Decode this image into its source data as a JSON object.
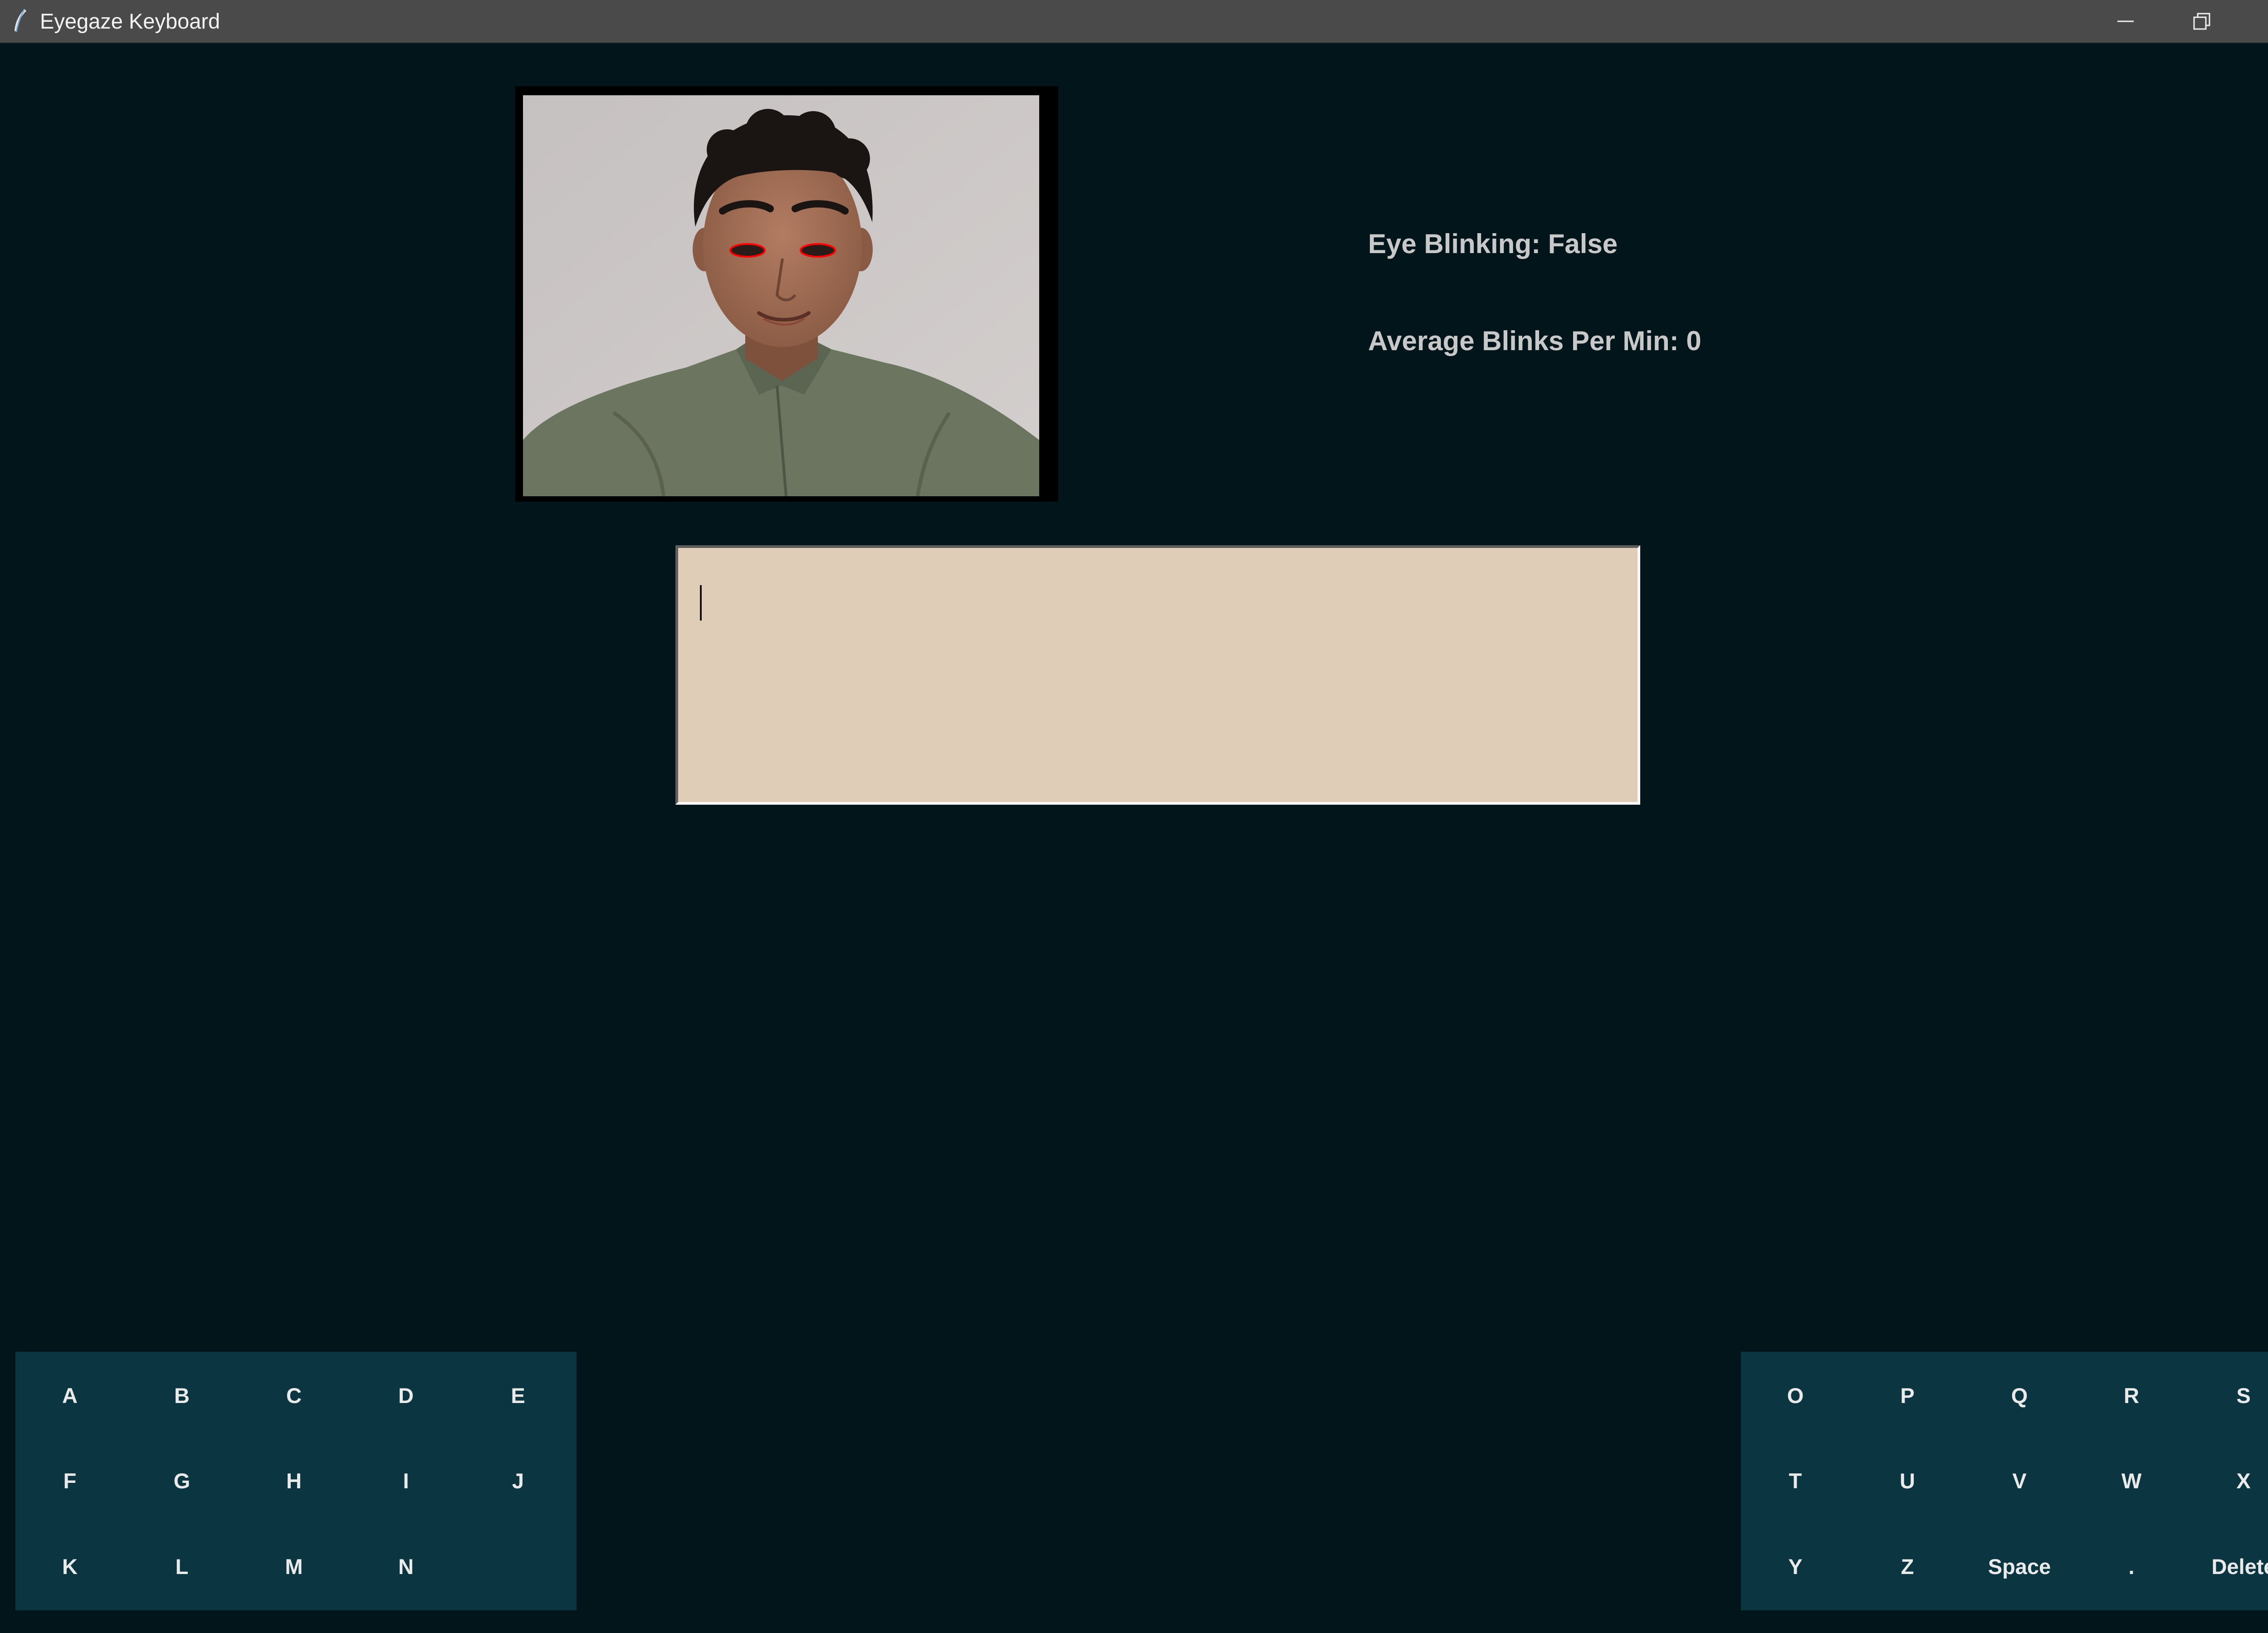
{
  "window": {
    "title": "Eyegaze Keyboard",
    "icon": "feather-icon"
  },
  "status": {
    "eye_blinking": "Eye Blinking: False",
    "average_blinks": "Average Blinks Per Min: 0"
  },
  "textbox": {
    "value": ""
  },
  "keyboard": {
    "left_rows": [
      [
        "A",
        "B",
        "C",
        "D",
        "E"
      ],
      [
        "F",
        "G",
        "H",
        "I",
        "J"
      ],
      [
        "K",
        "L",
        "M",
        "N"
      ]
    ],
    "right_rows": [
      [
        "O",
        "P",
        "Q",
        "R",
        "S"
      ],
      [
        "T",
        "U",
        "V",
        "W",
        "X"
      ],
      [
        "Y",
        "Z",
        "Space",
        ".",
        "Delete"
      ]
    ]
  },
  "colors": {
    "background": "#02151b",
    "titlebar": "#4a4a4a",
    "keyboard_panel": "#0b3540",
    "textbox": "#e0cdb7",
    "status_text": "#c8c8c8",
    "eye_marker": "#ff0000"
  }
}
